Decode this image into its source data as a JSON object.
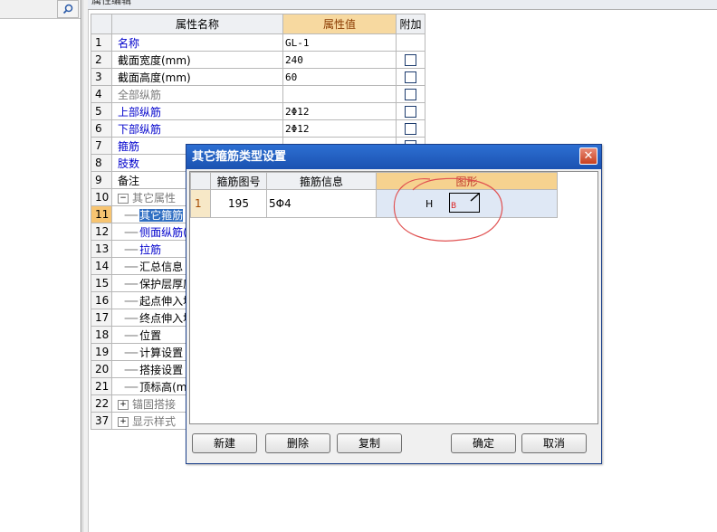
{
  "panel_header": "属性编辑",
  "table": {
    "headers": {
      "name": "属性名称",
      "value": "属性值",
      "extra": "附加"
    },
    "rows": [
      {
        "no": "1",
        "name": "名称",
        "value": "GL-1",
        "color": "blue",
        "check": false,
        "tree": ""
      },
      {
        "no": "2",
        "name": "截面宽度(mm)",
        "value": "240",
        "color": "black",
        "check": true,
        "tree": ""
      },
      {
        "no": "3",
        "name": "截面高度(mm)",
        "value": "60",
        "color": "black",
        "check": true,
        "tree": ""
      },
      {
        "no": "4",
        "name": "全部纵筋",
        "value": "",
        "color": "gray",
        "check": true,
        "tree": ""
      },
      {
        "no": "5",
        "name": "上部纵筋",
        "value": "2Φ12",
        "color": "blue",
        "check": true,
        "tree": ""
      },
      {
        "no": "6",
        "name": "下部纵筋",
        "value": "2Φ12",
        "color": "blue",
        "check": true,
        "tree": ""
      },
      {
        "no": "7",
        "name": "箍筋",
        "value": "",
        "color": "blue",
        "check": true,
        "tree": ""
      },
      {
        "no": "8",
        "name": "肢数",
        "value": "",
        "color": "blue",
        "check": false,
        "tree": ""
      },
      {
        "no": "9",
        "name": "备注",
        "value": "",
        "color": "black",
        "check": false,
        "tree": ""
      },
      {
        "no": "10",
        "name": "其它属性",
        "value": "",
        "color": "gray",
        "check": false,
        "tree": "−"
      },
      {
        "no": "11",
        "name": "其它箍筋",
        "value": "",
        "color": "selected",
        "check": false,
        "tree": "child"
      },
      {
        "no": "12",
        "name": "侧面纵筋(",
        "value": "",
        "color": "blue",
        "check": false,
        "tree": "child"
      },
      {
        "no": "13",
        "name": "拉筋",
        "value": "",
        "color": "blue",
        "check": false,
        "tree": "child"
      },
      {
        "no": "14",
        "name": "汇总信息",
        "value": "",
        "color": "black",
        "check": false,
        "tree": "child"
      },
      {
        "no": "15",
        "name": "保护层厚度",
        "value": "",
        "color": "black",
        "check": false,
        "tree": "child"
      },
      {
        "no": "16",
        "name": "起点伸入墙",
        "value": "",
        "color": "black",
        "check": false,
        "tree": "child"
      },
      {
        "no": "17",
        "name": "终点伸入墙",
        "value": "",
        "color": "black",
        "check": false,
        "tree": "child"
      },
      {
        "no": "18",
        "name": "位置",
        "value": "",
        "color": "black",
        "check": false,
        "tree": "child"
      },
      {
        "no": "19",
        "name": "计算设置",
        "value": "",
        "color": "black",
        "check": false,
        "tree": "child"
      },
      {
        "no": "20",
        "name": "搭接设置",
        "value": "",
        "color": "black",
        "check": false,
        "tree": "child"
      },
      {
        "no": "21",
        "name": "顶标高(m)",
        "value": "",
        "color": "black",
        "check": false,
        "tree": "child"
      },
      {
        "no": "22",
        "name": "锚固搭接",
        "value": "",
        "color": "gray",
        "check": false,
        "tree": "+"
      },
      {
        "no": "37",
        "name": "显示样式",
        "value": "",
        "color": "gray",
        "check": false,
        "tree": "+"
      }
    ]
  },
  "dialog": {
    "title": "其它箍筋类型设置",
    "close": "✕",
    "headers": {
      "no": "箍筋图号",
      "info": "箍筋信息",
      "shape": "图形"
    },
    "rows": [
      {
        "row": "1",
        "no": "195",
        "info": "5Φ4",
        "shape_h": "H",
        "shape_b": "B"
      }
    ],
    "buttons": {
      "new": "新建",
      "delete": "删除",
      "copy": "复制",
      "ok": "确定",
      "cancel": "取消"
    }
  },
  "colors": {
    "title": "#1b52b1",
    "highlight": "#f7d9a0",
    "annotation": "#e05050"
  }
}
